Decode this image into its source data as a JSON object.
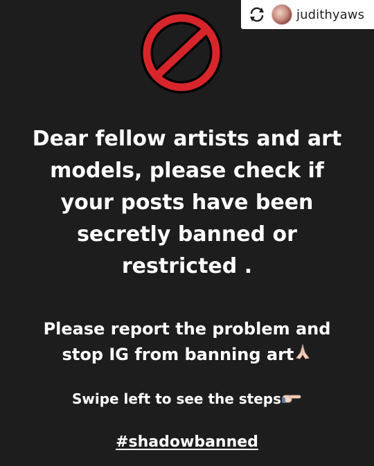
{
  "repost": {
    "username": "judithyaws",
    "icon": "repost-icon",
    "avatar": "avatar"
  },
  "graphic": {
    "icon": "no-symbol-icon",
    "color": "#d7262b"
  },
  "headline": "Dear fellow artists and art models, please check if your posts have been secretly banned or restricted .",
  "report": {
    "text": "Please report the problem and stop IG from banning art",
    "emoji": "folded-hands-icon"
  },
  "swipe": {
    "text": "Swipe left to see the steps",
    "emoji": "pointing-hand-icon"
  },
  "hashtag": "#shadowbanned",
  "colors": {
    "background": "#1d1d1d",
    "text": "#ffffff",
    "badge": "#ffffff"
  }
}
